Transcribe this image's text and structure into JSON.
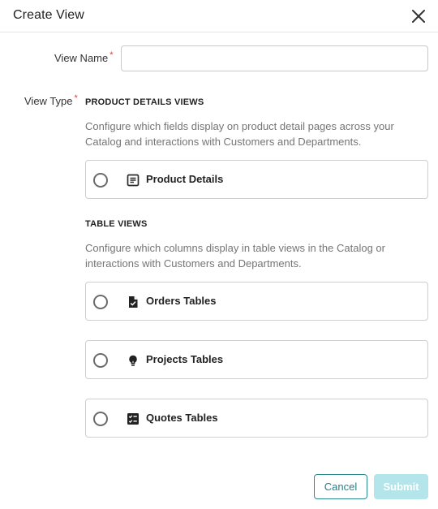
{
  "dialog": {
    "title": "Create View",
    "close_icon": "close-icon"
  },
  "form": {
    "view_name_label": "View Name",
    "view_name_value": "",
    "view_name_placeholder": "",
    "view_type_label": "View Type",
    "required_mark": "*"
  },
  "sections": {
    "product": {
      "heading": "PRODUCT DETAILS VIEWS",
      "description": "Configure which fields display on product detail pages across your Catalog and interactions with Customers and Departments.",
      "options": [
        {
          "label": "Product Details",
          "icon": "article-icon",
          "selected": false
        }
      ]
    },
    "table": {
      "heading": "TABLE VIEWS",
      "description": "Configure which columns display in table views in the Catalog or interactions with Customers and Departments.",
      "options": [
        {
          "label": "Orders Tables",
          "icon": "file-check-icon",
          "selected": false
        },
        {
          "label": "Projects Tables",
          "icon": "lightbulb-icon",
          "selected": false
        },
        {
          "label": "Quotes Tables",
          "icon": "checklist-icon",
          "selected": false
        }
      ]
    }
  },
  "footer": {
    "cancel_label": "Cancel",
    "submit_label": "Submit"
  },
  "colors": {
    "accent": "#2a8c8c",
    "submit_disabled_bg": "#b3e5ea",
    "required": "#e53935"
  }
}
